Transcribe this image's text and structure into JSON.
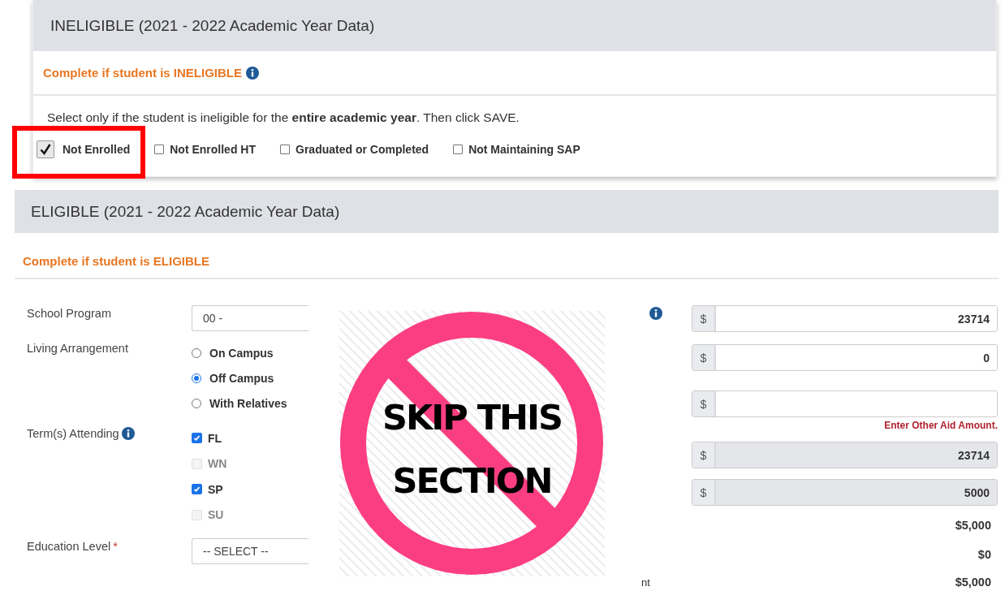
{
  "ineligible": {
    "title": "INELIGIBLE (2021 - 2022 Academic Year Data)",
    "subtitle": "Complete if student is INELIGIBLE",
    "subtitle_info": true,
    "instruction": "Select only if the student is ineligible for the **entire academic year**. Then click SAVE.",
    "options": [
      {
        "label": "Not Enrolled",
        "checked": true,
        "highlighted": true
      },
      {
        "label": "Not Enrolled HT",
        "checked": false,
        "highlighted": false
      },
      {
        "label": "Graduated or Completed",
        "checked": false,
        "highlighted": false
      },
      {
        "label": "Not Maintaining SAP",
        "checked": false,
        "highlighted": false
      }
    ]
  },
  "eligible": {
    "title": "ELIGIBLE (2021 - 2022 Academic Year Data)",
    "subtitle": "Complete if student is ELIGIBLE",
    "school_program": {
      "label": "School Program",
      "value": "00 -"
    },
    "living_arrangement": {
      "label": "Living Arrangement",
      "options": [
        {
          "label": "On Campus",
          "selected": false
        },
        {
          "label": "Off Campus",
          "selected": true
        },
        {
          "label": "With Relatives",
          "selected": false
        }
      ]
    },
    "terms": {
      "label": "Term(s) Attending",
      "info": true,
      "options": [
        {
          "label": "FL",
          "checked": true,
          "disabled": false
        },
        {
          "label": "WN",
          "checked": false,
          "disabled": true
        },
        {
          "label": "SP",
          "checked": true,
          "disabled": false
        },
        {
          "label": "SU",
          "checked": false,
          "disabled": true
        }
      ]
    },
    "education_level": {
      "label": "Education Level",
      "required_mark": "*",
      "value": "-- SELECT --"
    },
    "amounts": [
      {
        "prefix": "$",
        "value": "23714",
        "disabled": false,
        "info": true
      },
      {
        "prefix": "$",
        "value": "0",
        "disabled": false
      },
      {
        "prefix": "$",
        "disabled": false,
        "error": "Enter Other Aid Amount."
      },
      {
        "prefix": "$",
        "value": "23714",
        "disabled": true
      },
      {
        "prefix": "$",
        "value": "5000",
        "disabled": true
      }
    ],
    "totals": [
      {
        "value": "$5,000"
      },
      {
        "value": "$0"
      },
      {
        "label": "nt",
        "value": "$5,000"
      }
    ]
  },
  "skip_sign": {
    "text": "SKIP THIS SECTION"
  }
}
